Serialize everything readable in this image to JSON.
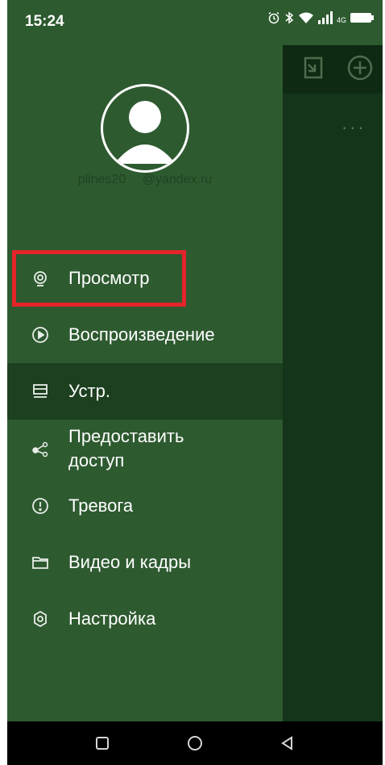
{
  "status_bar": {
    "time": "15:24",
    "icons": [
      "alarm-icon",
      "bluetooth-icon",
      "wifi-icon",
      "signal-icon",
      "4g-icon",
      "battery-icon"
    ],
    "network_label": "4G"
  },
  "drawer": {
    "account": {
      "username": "plines20",
      "domain": "@yandex.ru"
    },
    "menu": [
      {
        "label": "Просмотр",
        "icon": "camera-view-icon"
      },
      {
        "label": "Воспроизведение",
        "icon": "play-circle-icon"
      },
      {
        "label": "Устр.",
        "icon": "device-list-icon",
        "active": true
      },
      {
        "label": "Предоставить доступ",
        "icon": "share-icon"
      },
      {
        "label": "Тревога",
        "icon": "alert-icon"
      },
      {
        "label": "Видео и кадры",
        "icon": "folder-icon"
      },
      {
        "label": "Настройка",
        "icon": "settings-icon"
      }
    ]
  },
  "app": {
    "more_label": "..."
  },
  "colors": {
    "drawer_bg": "#2e5a30",
    "active_bg": "#1d4020",
    "status_bg": "#2d5a2f",
    "highlight": "#e4242a"
  }
}
